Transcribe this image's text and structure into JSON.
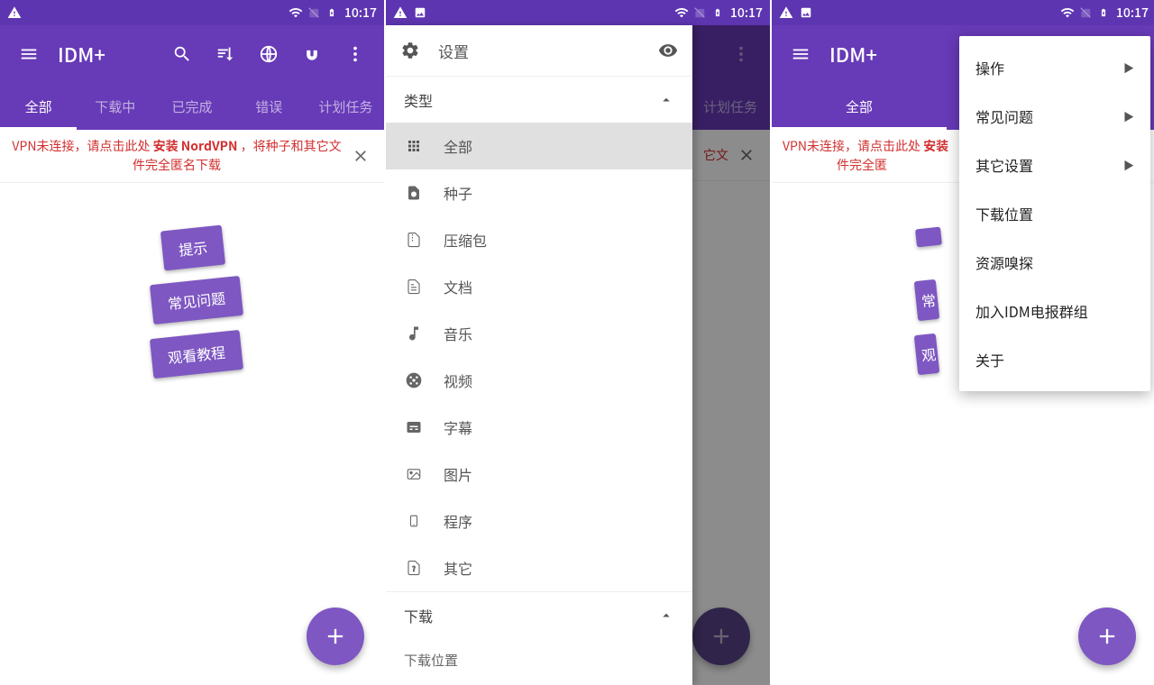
{
  "status": {
    "time": "10:17"
  },
  "appbar": {
    "title": "IDM+"
  },
  "tabs": [
    "全部",
    "下载中",
    "已完成",
    "错误",
    "计划任务"
  ],
  "banner": {
    "t1": "VPN未连接，请点击此处 ",
    "bold": "安装 NordVPN",
    "t2": " ，将种子和其它文件完全匿名下载"
  },
  "chips": {
    "tip": "提示",
    "faq": "常见问题",
    "tutorial": "观看教程"
  },
  "drawer": {
    "settings_label": "设置",
    "types_label": "类型",
    "downloads_label": "下载",
    "location_label": "下载位置",
    "items": [
      {
        "label": "全部"
      },
      {
        "label": "种子"
      },
      {
        "label": "压缩包"
      },
      {
        "label": "文档"
      },
      {
        "label": "音乐"
      },
      {
        "label": "视频"
      },
      {
        "label": "字幕"
      },
      {
        "label": "图片"
      },
      {
        "label": "程序"
      },
      {
        "label": "其它"
      }
    ]
  },
  "popup": {
    "items": [
      {
        "label": "操作",
        "sub": true
      },
      {
        "label": "常见问题",
        "sub": true
      },
      {
        "label": "其它设置",
        "sub": true
      },
      {
        "label": "下载位置",
        "sub": false
      },
      {
        "label": "资源嗅探",
        "sub": false
      },
      {
        "label": "加入IDM电报群组",
        "sub": false
      },
      {
        "label": "关于",
        "sub": false
      }
    ]
  }
}
